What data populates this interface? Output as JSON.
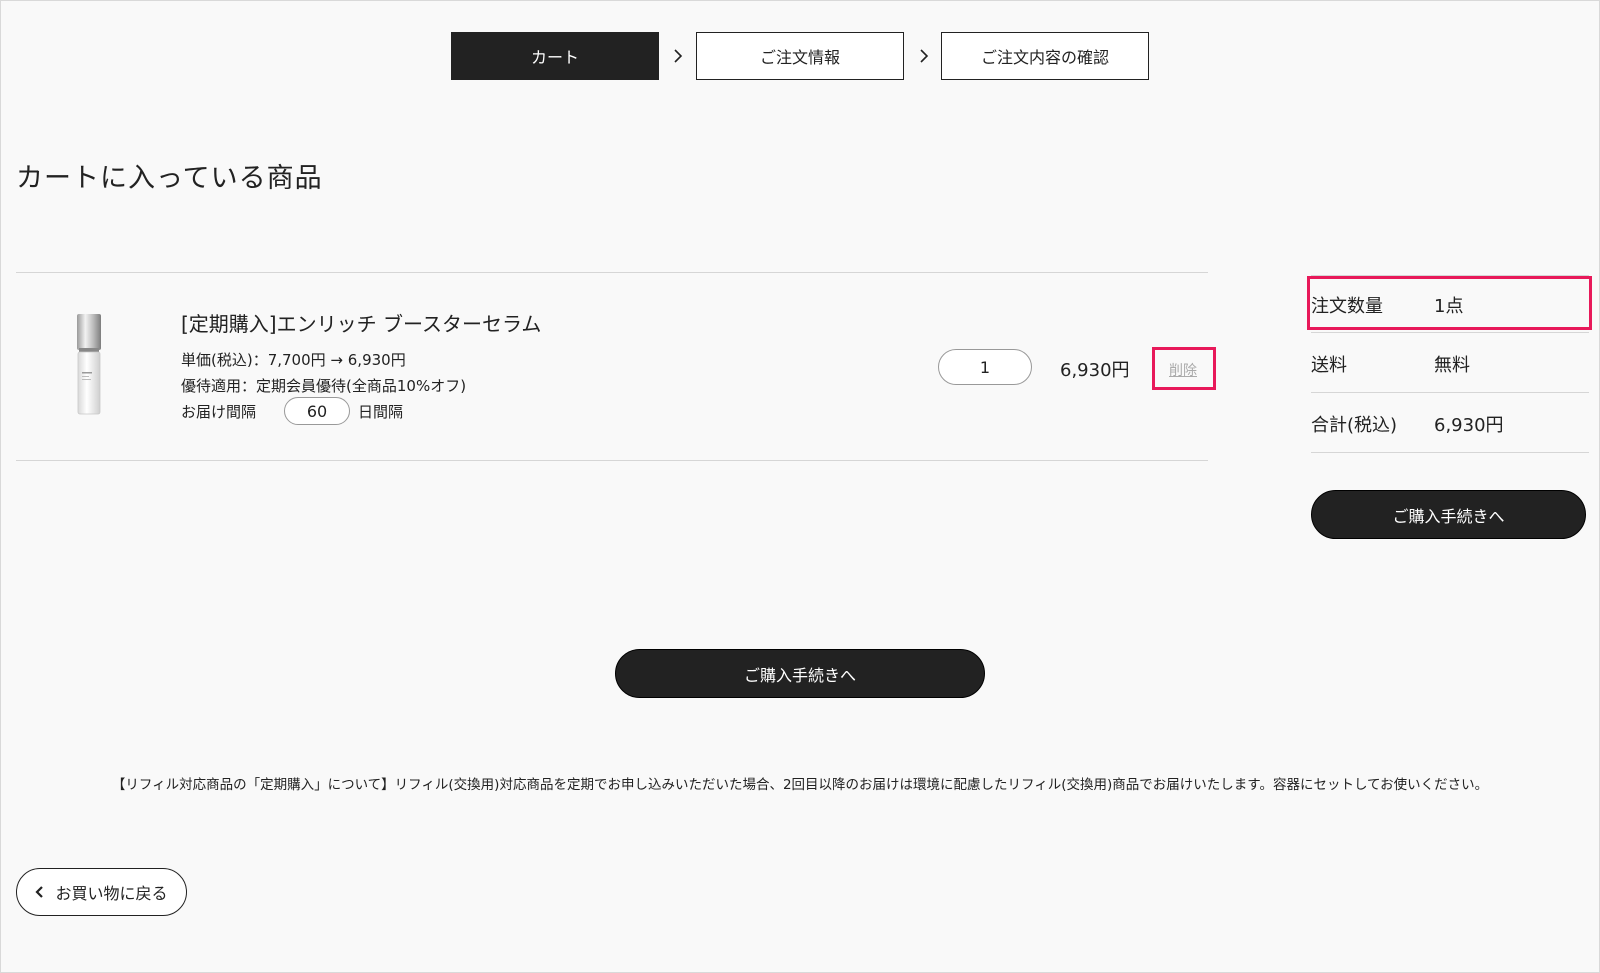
{
  "steps": [
    {
      "label": "カート",
      "active": true
    },
    {
      "label": "ご注文情報",
      "active": false
    },
    {
      "label": "ご注文内容の確認",
      "active": false
    }
  ],
  "page_title": "カートに入っている商品",
  "cart_item": {
    "name": "[定期購入]エンリッチ ブースターセラム",
    "unit_price": "単価(税込)：7,700円 → 6,930円",
    "benefit": "優待適用：定期会員優待(全商品10%オフ)",
    "interval_label": "お届け間隔",
    "interval_value": "60",
    "interval_suffix": "日間隔",
    "quantity": "1",
    "line_price": "6,930円",
    "delete_label": "削除",
    "image_icon": "serum-bottle-icon"
  },
  "summary": {
    "qty_label": "注文数量",
    "qty_value": "1点",
    "shipping_label": "送料",
    "shipping_value": "無料",
    "total_label": "合計(税込)",
    "total_value": "6,930円",
    "checkout_label": "ご購入手続きへ"
  },
  "checkout_button_label": "ご購入手続きへ",
  "notice": "【リフィル対応商品の「定期購入」について】リフィル(交換用)対応商品を定期でお申し込みいただいた場合、2回目以降のお届けは環境に配慮したリフィル(交換用)商品でお届けいたします。容器にセットしてお使いください。",
  "back_button": {
    "label": "お買い物に戻る",
    "icon": "chevron-left-icon"
  },
  "colors": {
    "dark": "#222222",
    "highlight": "#e8195a",
    "background": "#f9f9f9"
  }
}
